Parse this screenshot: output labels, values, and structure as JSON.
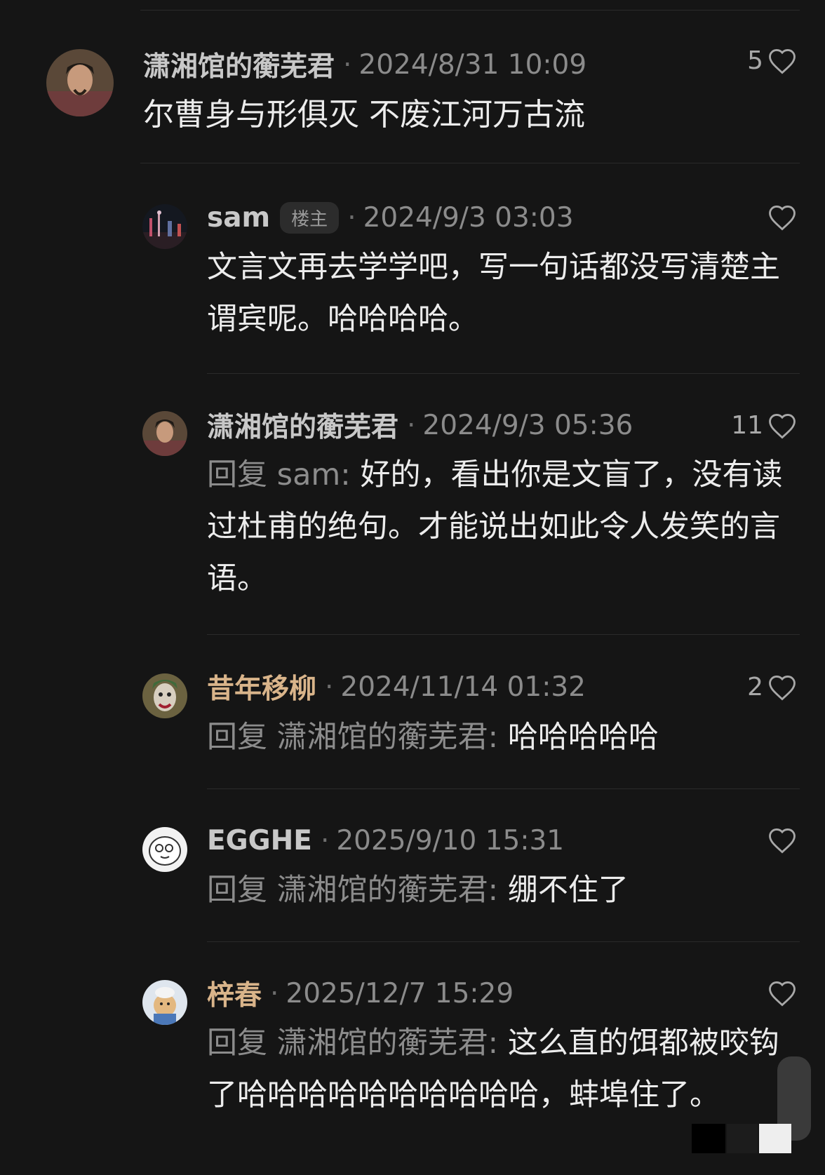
{
  "colors": {
    "background": "#151515",
    "username": "#c8c8c8",
    "username_highlight": "#d9b48a",
    "body": "#ececec",
    "muted": "#8b8b8b"
  },
  "comments": [
    {
      "username": "潇湘馆的蘅芜君",
      "time": "2024/8/31 10:09",
      "likes": "5",
      "text": "尔曹身与形俱灭 不废江河万古流"
    },
    {
      "username": "sam",
      "badge": "楼主",
      "time": "2024/9/3 03:03",
      "likes": "",
      "text": "文言文再去学学吧，写一句话都没写清楚主谓宾呢。哈哈哈哈。"
    },
    {
      "username": "潇湘馆的蘅芜君",
      "time": "2024/9/3 05:36",
      "likes": "11",
      "reply_prefix": "回复 sam: ",
      "text": "好的，看出你是文盲了，没有读过杜甫的绝句。才能说出如此令人发笑的言语。"
    },
    {
      "username": "昔年移柳",
      "time": "2024/11/14 01:32",
      "likes": "2",
      "reply_prefix": "回复 潇湘馆的蘅芜君: ",
      "text": "哈哈哈哈哈"
    },
    {
      "username": "EGGHE",
      "time": "2025/9/10 15:31",
      "likes": "",
      "reply_prefix": "回复 潇湘馆的蘅芜君: ",
      "text": "绷不住了"
    },
    {
      "username": "梓春",
      "time": "2025/12/7 15:29",
      "likes": "",
      "reply_prefix": "回复 潇湘馆的蘅芜君: ",
      "text": "这么直的饵都被咬钩了哈哈哈哈哈哈哈哈哈哈，蚌埠住了。"
    }
  ],
  "separator": "·"
}
